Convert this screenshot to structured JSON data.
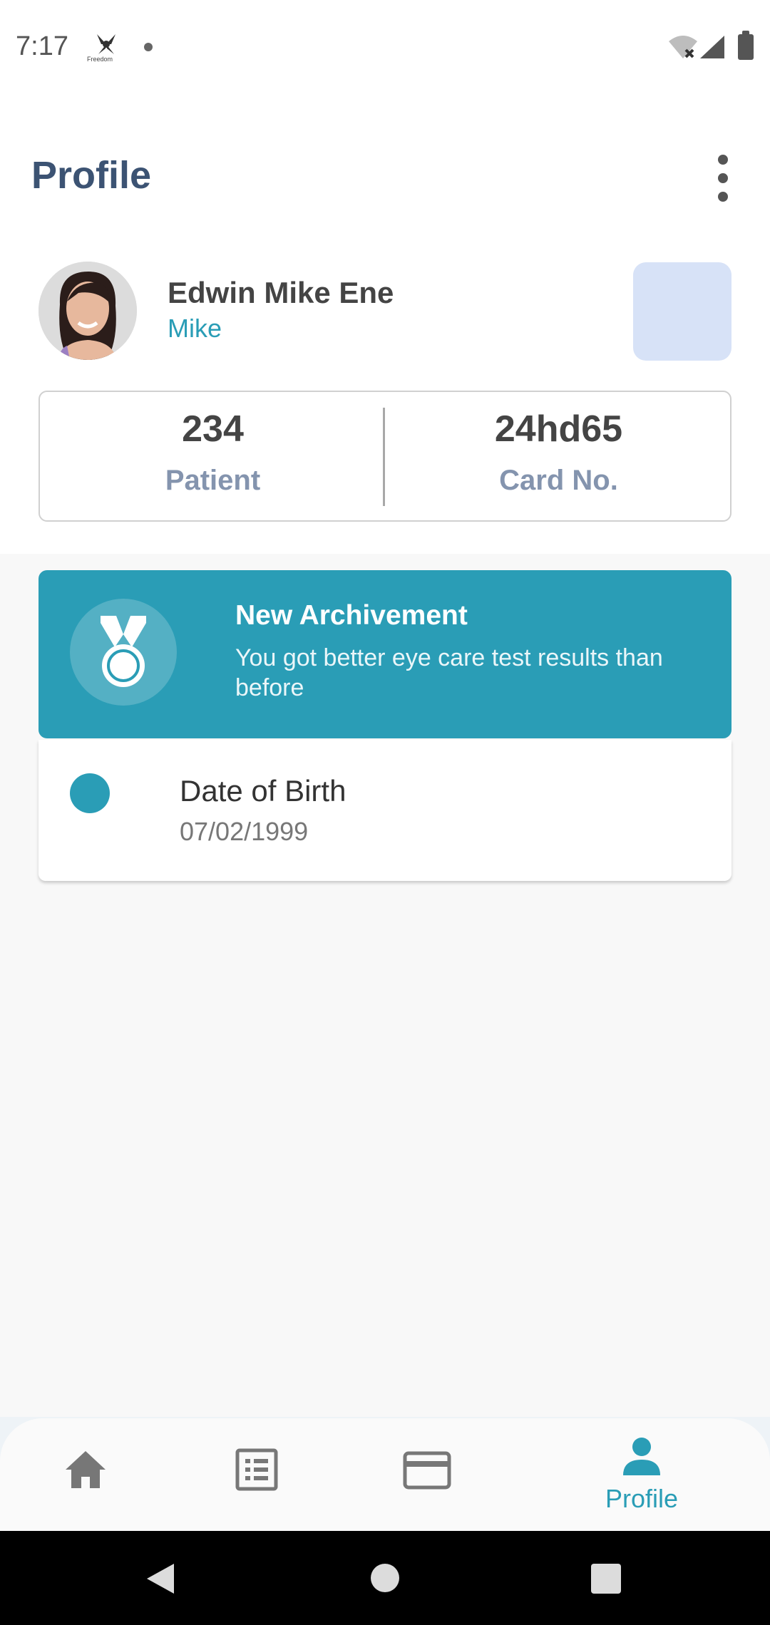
{
  "status_bar": {
    "time": "7:17",
    "app_icon_label": "Freedom"
  },
  "header": {
    "title": "Profile"
  },
  "user": {
    "name": "Edwin Mike Ene",
    "nickname": "Mike"
  },
  "stats": {
    "patient_value": "234",
    "patient_label": "Patient",
    "card_value": "24hd65",
    "card_label": "Card No."
  },
  "achievement": {
    "title": "New Archivement",
    "text": "You got better eye care test results than before"
  },
  "dob": {
    "label": "Date of Birth",
    "value": "07/02/1999"
  },
  "bottom_nav": {
    "items": [
      {
        "icon": "home-icon",
        "label": ""
      },
      {
        "icon": "list-icon",
        "label": ""
      },
      {
        "icon": "card-icon",
        "label": ""
      },
      {
        "icon": "person-icon",
        "label": "Profile",
        "active": true
      }
    ]
  },
  "colors": {
    "accent": "#2a9db6",
    "title": "#3c5373",
    "muted_label": "#8494ae",
    "qr_placeholder": "#d7e2f7"
  }
}
